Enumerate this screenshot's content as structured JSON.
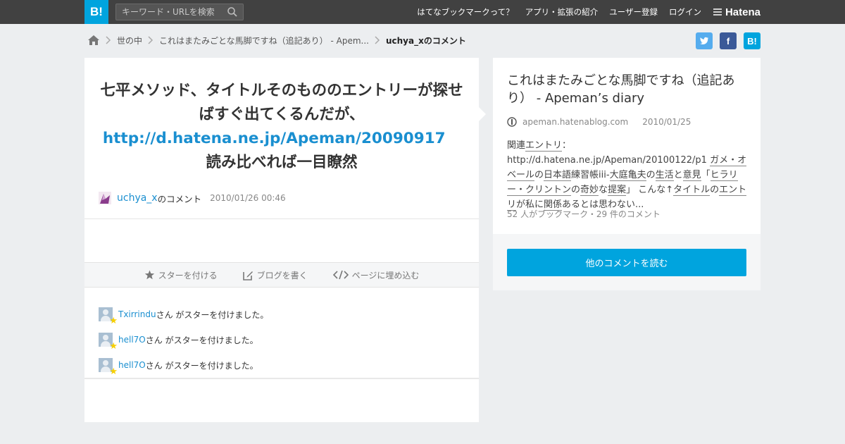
{
  "header": {
    "logo_text": "B!",
    "search_placeholder": "キーワード・URLを検索",
    "nav": [
      "はてなブックマークって？",
      "アプリ・拡張の紹介",
      "ユーザー登録",
      "ログイン"
    ],
    "brand": "Hatena"
  },
  "breadcrumb": {
    "items": [
      "世の中",
      "これはまたみごとな馬脚ですね（追記あり） - Apem..."
    ],
    "current": "uchya_xのコメント"
  },
  "social": {
    "facebook": "f",
    "hatena": "B!"
  },
  "comment": {
    "text_before": "七平メソッド、タイトルそのもののエントリーが探せばすぐ出てくるんだが、",
    "link": "http://d.hatena.ne.jp/Apeman/20090917",
    "text_after": "　読み比べれば一目瞭然",
    "author": "uchya_x",
    "author_suffix": "のコメント",
    "timestamp": "2010/01/26 00:46"
  },
  "actions": [
    "スターを付ける",
    "ブログを書く",
    "ページに埋め込む"
  ],
  "stars": [
    {
      "user": "Txirrindu",
      "text": "さん がスターを付けました。"
    },
    {
      "user": "hell7O",
      "text": "さん がスターを付けました。"
    },
    {
      "user": "hell7O",
      "text": "さん がスターを付けました。"
    }
  ],
  "entry": {
    "title": "これはまたみごとな馬脚ですね（追記あり） - Apeman’s diary",
    "domain": "apeman.hatenablog.com",
    "date": "2010/01/25",
    "desc_parts": [
      "関連",
      "エントリ",
      "：http://d.hatena.ne.jp/Apeman/20100122/p1 ",
      "ガメ・オベール",
      "の",
      "日本語",
      "練習帳iii-",
      "大庭亀夫",
      "の",
      "生活",
      "と",
      "意見",
      "「",
      "ヒラリー・クリントン",
      "の",
      "奇妙",
      "な",
      "提案",
      "」 こんな↑",
      "タイトル",
      "の",
      "エントリ",
      "が私に",
      "関係",
      "あるとは思わない..."
    ],
    "stats": "52 人がブックマーク・29 件のコメント",
    "read_button": "他のコメントを読む"
  }
}
